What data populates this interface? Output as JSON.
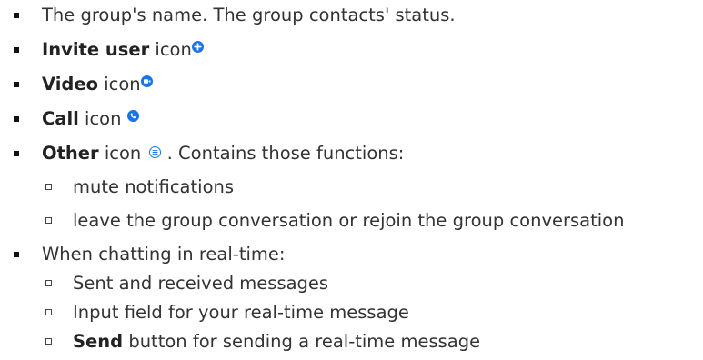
{
  "items": [
    {
      "text": "The group's name. The group contacts' status."
    },
    {
      "bold": "Invite user",
      "text": " icon",
      "icon": "add-circle-icon"
    },
    {
      "bold": "Video",
      "text": " icon",
      "icon": "video-circle-icon"
    },
    {
      "bold": "Call",
      "text": " icon ",
      "icon": "phone-circle-icon"
    },
    {
      "bold": "Other",
      "text_before": " icon ",
      "icon": "menu-circle-icon",
      "text_after": " . Contains those functions:",
      "subitems": [
        "mute notifications",
        "leave the group conversation or rejoin the group conversation"
      ]
    },
    {
      "text": "When chatting in real-time:",
      "subitems": [
        {
          "text": "Sent and received messages"
        },
        {
          "text": "Input field for your real-time message"
        },
        {
          "bold": "Send",
          "text": " button for sending a real-time message"
        }
      ]
    }
  ],
  "colors": {
    "icon_blue": "#1a73e8",
    "text": "#333333"
  }
}
